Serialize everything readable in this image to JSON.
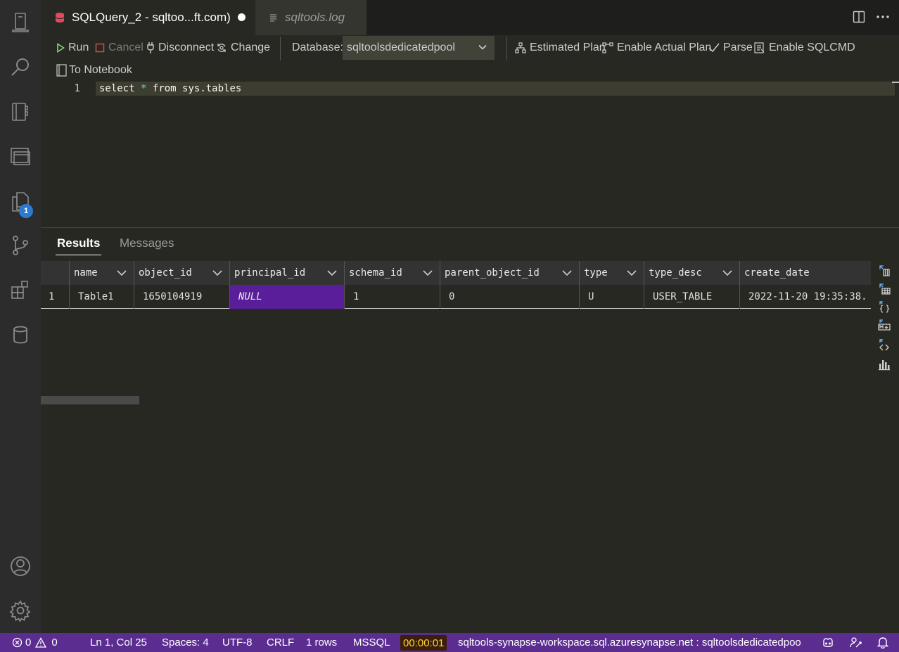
{
  "tabs": [
    {
      "title": "SQLQuery_2 - sqltoo...ft.com)",
      "active": true,
      "modified": true
    },
    {
      "title": "sqltools.log",
      "active": false
    }
  ],
  "toolbar": {
    "run": "Run",
    "cancel": "Cancel",
    "disconnect": "Disconnect",
    "change": "Change",
    "database_label": "Database:",
    "database_value": "sqltoolsdedicatedpool",
    "estimated_plan": "Estimated Plan",
    "enable_actual_plan": "Enable Actual Plan",
    "parse": "Parse",
    "enable_sqlcmd": "Enable SQLCMD",
    "to_notebook": "To Notebook"
  },
  "editor": {
    "line_number": "1",
    "tokens": [
      "select",
      " ",
      "*",
      " ",
      "from",
      " sys.tables"
    ]
  },
  "activity_badge": "1",
  "results": {
    "tabs": {
      "results": "Results",
      "messages": "Messages"
    },
    "columns": [
      "name",
      "object_id",
      "principal_id",
      "schema_id",
      "parent_object_id",
      "type",
      "type_desc",
      "create_date"
    ],
    "rows": [
      {
        "row_number": "1",
        "cells": [
          "Table1",
          "1650104919",
          "NULL",
          "1",
          "0",
          "U",
          "USER_TABLE",
          "2022-11-20 19:35:38."
        ]
      }
    ]
  },
  "status": {
    "errors": "0",
    "warnings": "0",
    "position": "Ln 1, Col 25",
    "spaces": "Spaces: 4",
    "encoding": "UTF-8",
    "eol": "CRLF",
    "rows": "1 rows",
    "language": "MSSQL",
    "elapsed": "00:00:01",
    "connection": "sqltools-synapse-workspace.sql.azuresynapse.net : sqltoolsdedicatedpoo"
  },
  "colors": {
    "status_bar": "#5c2d91",
    "selected_cell": "#5a1e9a",
    "editor_bg": "#272822",
    "badge": "#2e7ad1"
  }
}
